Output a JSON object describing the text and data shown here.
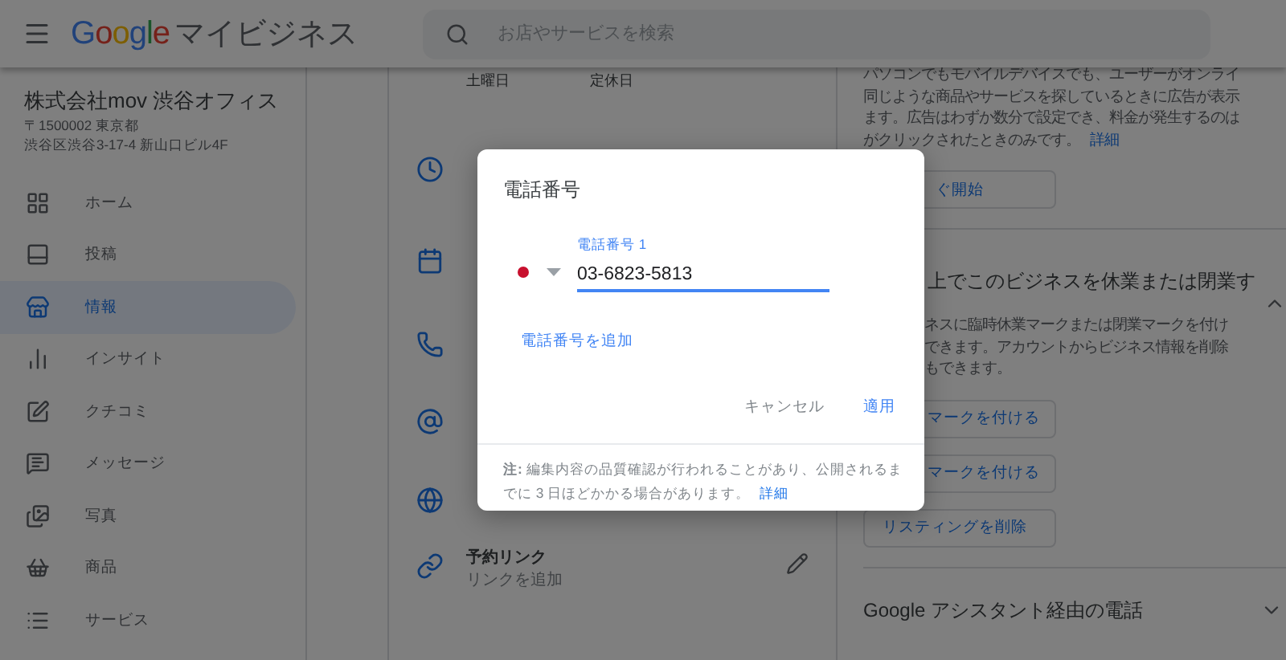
{
  "header": {
    "logo": "Google",
    "product": "マイビジネス",
    "search": {
      "placeholder": "お店やサービスを検索"
    }
  },
  "business": {
    "name": "株式会社mov 渋谷オフィス",
    "address_lines": [
      "〒1500002 東京都",
      "渋谷区渋谷3-17-4 新山口ビル4F"
    ]
  },
  "nav": [
    {
      "label": "ホーム",
      "selected": false
    },
    {
      "label": "投稿",
      "selected": false
    },
    {
      "label": "情報",
      "selected": true
    },
    {
      "label": "インサイト",
      "selected": false
    },
    {
      "label": "クチコミ",
      "selected": false
    },
    {
      "label": "メッセージ",
      "selected": false
    },
    {
      "label": "写真",
      "selected": false
    },
    {
      "label": "商品",
      "selected": false
    },
    {
      "label": "サービス",
      "selected": false
    }
  ],
  "hours_row": {
    "day": "土曜日",
    "status": "定休日"
  },
  "link_row": {
    "title": "予約リンク",
    "value": "リンクを追加"
  },
  "ads": {
    "lines": [
      "パソコンでもモバイルデバイスでも、ユーザーがオンライ",
      "同じような商品やサービスを探しているときに広告が表示",
      "ます。広告はわずか数分で設定でき、料金が発生するのは",
      "がクリックされたときのみです。"
    ],
    "link": "詳細",
    "button": "ぐ開始"
  },
  "close_section": {
    "title": "上でこのビジネスを休業または閉業す",
    "expanded": true,
    "lines": [
      "ネスに臨時休業マークまたは閉業マークを付け",
      "できます。アカウントからビジネス情報を削除",
      "もできます。"
    ],
    "buttons": [
      {
        "label": "マークを付ける",
        "kind": "partial"
      },
      {
        "label": "マークを付ける",
        "kind": "partial"
      },
      {
        "label": "リスティングを削除",
        "kind": "full"
      }
    ]
  },
  "assistant_section": {
    "title": "Google アシスタント経由の電話",
    "expanded": false
  },
  "dialog": {
    "title": "電話番号",
    "field_label": "電話番号 1",
    "value": "03-6823-5813",
    "add_link": "電話番号を追加",
    "buttons": [
      {
        "label": "キャンセル",
        "kind": "secondary"
      },
      {
        "label": "適用",
        "kind": "primary"
      }
    ],
    "note": "**注:** 編集内容の品質確認が行われることがあり、公開されるまでに 3 日ほどかかる場合があります。",
    "note_link": "詳細"
  }
}
